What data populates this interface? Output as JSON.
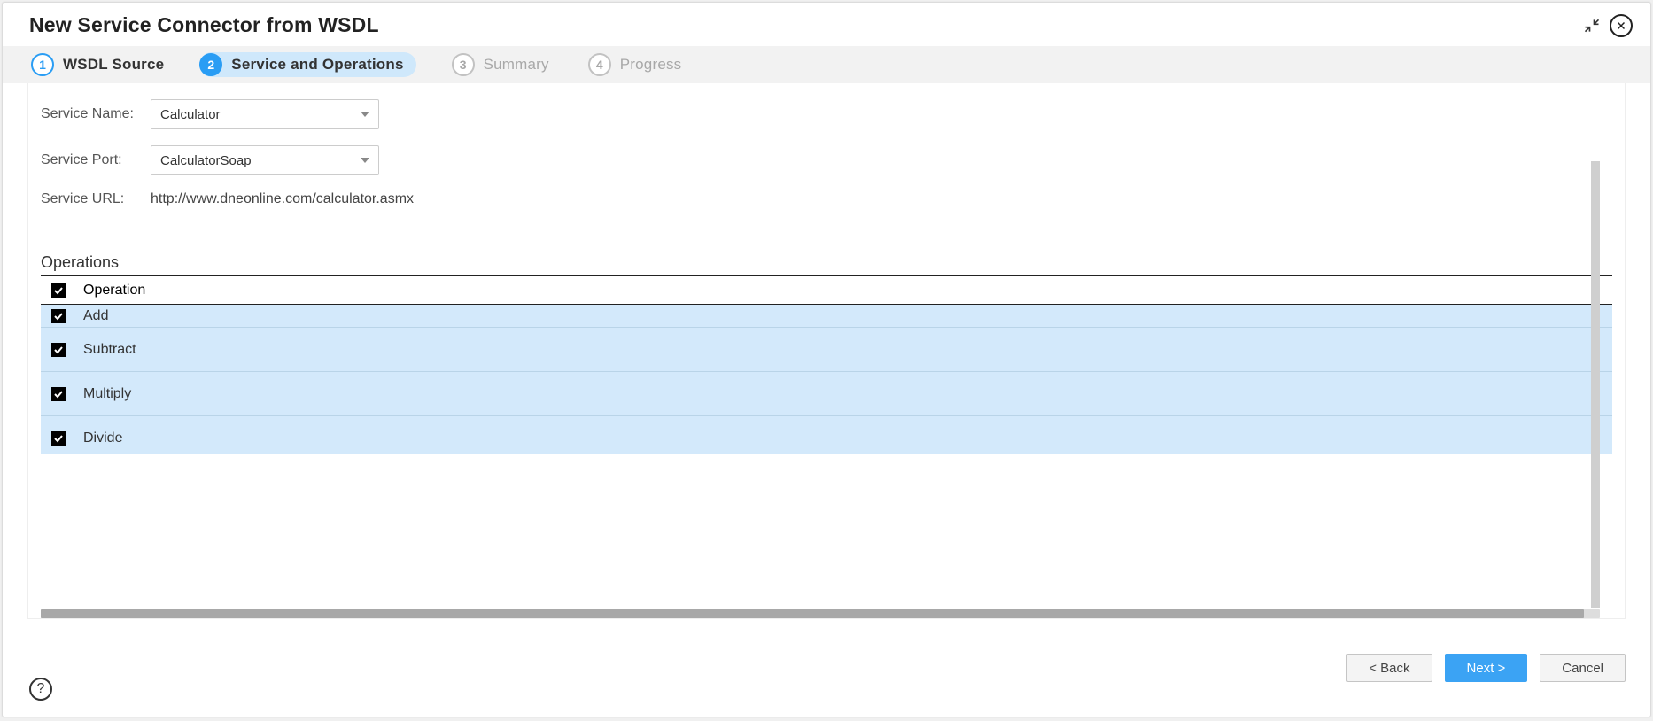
{
  "dialog": {
    "title": "New Service Connector from WSDL"
  },
  "steps": [
    {
      "num": "1",
      "label": "WSDL Source",
      "state": "completed"
    },
    {
      "num": "2",
      "label": "Service and Operations",
      "state": "active"
    },
    {
      "num": "3",
      "label": "Summary",
      "state": "pending"
    },
    {
      "num": "4",
      "label": "Progress",
      "state": "pending"
    }
  ],
  "form": {
    "service_name_label": "Service Name:",
    "service_name_value": "Calculator",
    "service_port_label": "Service Port:",
    "service_port_value": "CalculatorSoap",
    "service_url_label": "Service URL:",
    "service_url_value": "http://www.dneonline.com/calculator.asmx"
  },
  "operations": {
    "heading": "Operations",
    "col_label": "Operation",
    "rows": [
      {
        "name": "Add",
        "checked": true
      },
      {
        "name": "Subtract",
        "checked": true
      },
      {
        "name": "Multiply",
        "checked": true
      },
      {
        "name": "Divide",
        "checked": true
      }
    ]
  },
  "buttons": {
    "back": "< Back",
    "next": "Next >",
    "cancel": "Cancel"
  },
  "help": "?"
}
